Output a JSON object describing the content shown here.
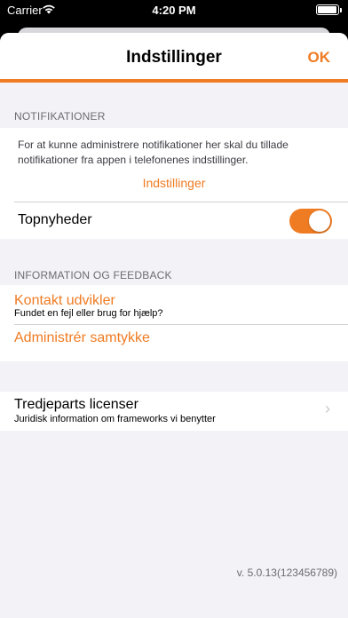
{
  "status_bar": {
    "carrier": "Carrier",
    "time": "4:20 PM"
  },
  "nav": {
    "title": "Indstillinger",
    "ok_label": "OK"
  },
  "notifications": {
    "header": "NOTIFIKATIONER",
    "note": "For at kunne administrere notifikationer her skal du tillade notifikationer fra appen i telefonenes indstillinger.",
    "settings_link": "Indstillinger",
    "topnews_label": "Topnyheder",
    "topnews_enabled": true
  },
  "info": {
    "header": "INFORMATION OG FEEDBACK",
    "contact_title": "Kontakt udvikler",
    "contact_subtitle": "Fundet en fejl eller brug for hjælp?",
    "consent_title": "Administrér samtykke"
  },
  "licenses": {
    "title": "Tredjeparts licenser",
    "subtitle": "Juridisk information om frameworks vi benytter"
  },
  "version": "v. 5.0.13(123456789)",
  "colors": {
    "accent": "#ef7b22",
    "background": "#f2f2f7"
  }
}
